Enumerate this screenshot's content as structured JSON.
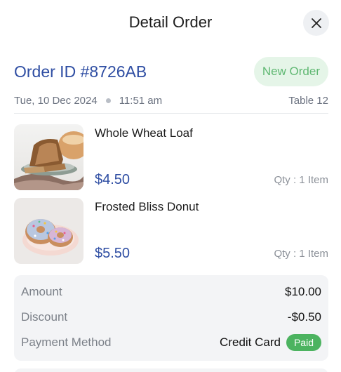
{
  "header": {
    "title": "Detail Order",
    "close_icon": "close-icon"
  },
  "order": {
    "id_label": "Order ID #8726AB",
    "status": "New Order",
    "date": "Tue, 10 Dec 2024",
    "time": "11:51 am",
    "table": "Table 12"
  },
  "items": [
    {
      "name": "Whole Wheat Loaf",
      "price": "$4.50",
      "qty": "Qty : 1 Item"
    },
    {
      "name": "Frosted Bliss Donut",
      "price": "$5.50",
      "qty": "Qty : 1 Item"
    }
  ],
  "summary": {
    "amount_label": "Amount",
    "amount_value": "$10.00",
    "discount_label": "Discount",
    "discount_value": "-$0.50",
    "payment_label": "Payment Method",
    "payment_value": "Credit Card",
    "payment_status": "Paid"
  },
  "colors": {
    "accent": "#2f4ea3",
    "status_bg": "#e5f5e8",
    "status_text": "#5fb872",
    "paid": "#4cb360"
  }
}
